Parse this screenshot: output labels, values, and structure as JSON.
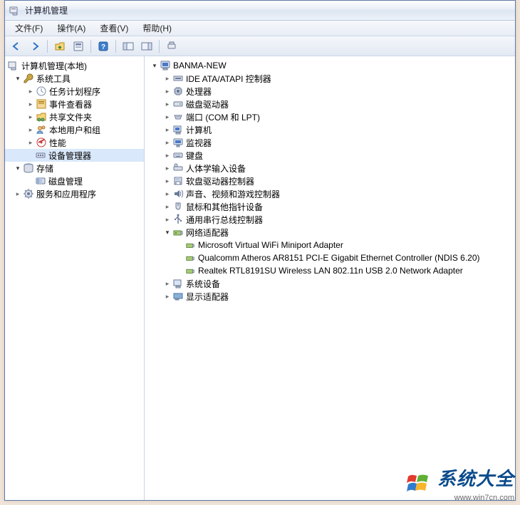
{
  "window": {
    "title": "计算机管理"
  },
  "menu": {
    "file": "文件(F)",
    "action": "操作(A)",
    "view": "查看(V)",
    "help": "帮助(H)"
  },
  "toolbar": {
    "back": "back",
    "forward": "forward",
    "up": "up",
    "props": "properties",
    "help": "help",
    "show1": "show-hide-console-tree",
    "show2": "show-hide-action-pane"
  },
  "leftTree": {
    "root": "计算机管理(本地)",
    "systemTools": "系统工具",
    "taskScheduler": "任务计划程序",
    "eventViewer": "事件查看器",
    "sharedFolders": "共享文件夹",
    "localUsers": "本地用户和组",
    "performance": "性能",
    "deviceManager": "设备管理器",
    "storage": "存储",
    "diskMgmt": "磁盘管理",
    "services": "服务和应用程序"
  },
  "rightTree": {
    "root": "BANMA-NEW",
    "ide": "IDE ATA/ATAPI 控制器",
    "cpu": "处理器",
    "diskDrive": "磁盘驱动器",
    "ports": "端口 (COM 和 LPT)",
    "computer": "计算机",
    "monitor": "监视器",
    "keyboard": "键盘",
    "hid": "人体学输入设备",
    "floppy": "软盘驱动器控制器",
    "sound": "声音、视频和游戏控制器",
    "mouse": "鼠标和其他指针设备",
    "usb": "通用串行总线控制器",
    "network": "网络适配器",
    "net1": "Microsoft Virtual WiFi Miniport Adapter",
    "net2": "Qualcomm Atheros AR8151 PCI-E Gigabit Ethernet Controller (NDIS 6.20)",
    "net3": "Realtek RTL8191SU Wireless LAN 802.11n USB 2.0 Network Adapter",
    "sysDevices": "系统设备",
    "display": "显示适配器"
  },
  "watermark": {
    "brand": "系统大全",
    "url": "www.win7cn.com"
  }
}
